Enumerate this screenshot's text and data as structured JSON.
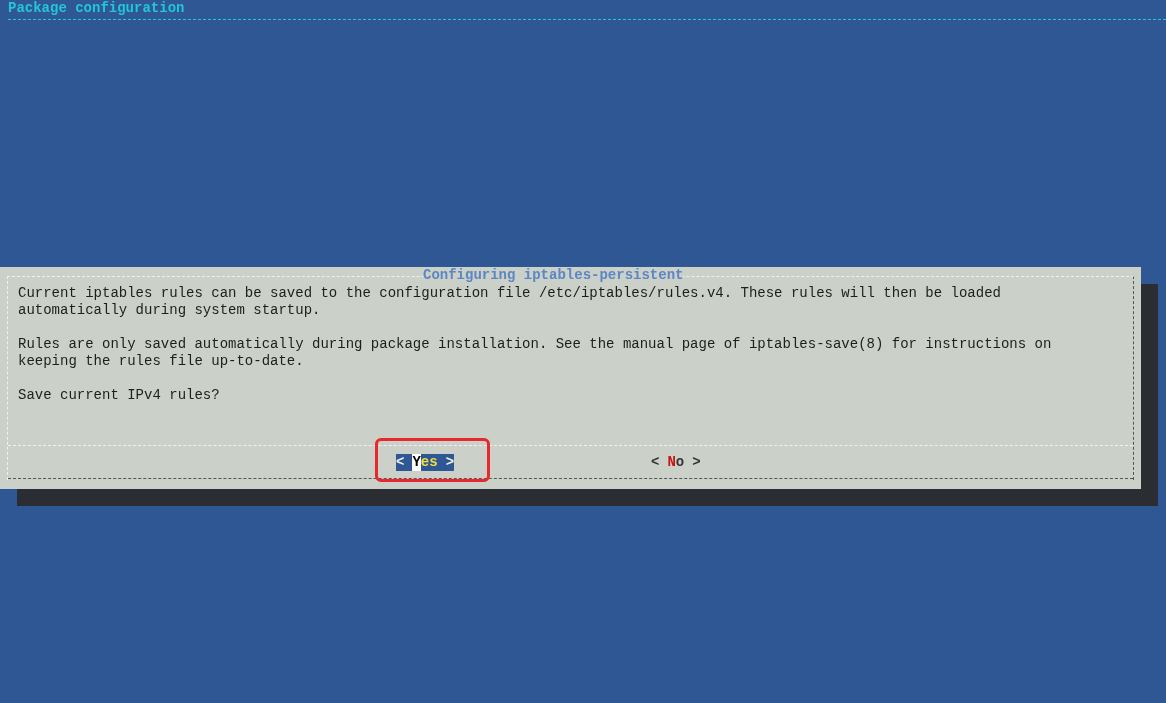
{
  "header": {
    "title": "Package configuration"
  },
  "dialog": {
    "title": "Configuring iptables-persistent",
    "paragraphs": [
      "Current iptables rules can be saved to the configuration file /etc/iptables/rules.v4. These rules will then be loaded automatically during system startup.",
      "Rules are only saved automatically during package installation. See the manual page of iptables-save(8) for instructions on keeping the rules file up-to-date.",
      "Save current IPv4 rules?"
    ],
    "buttons": [
      {
        "open": "<",
        "label": "Yes",
        "close": ">",
        "selected": true
      },
      {
        "open": "<",
        "label": "No",
        "close": ">",
        "selected": false
      }
    ]
  }
}
